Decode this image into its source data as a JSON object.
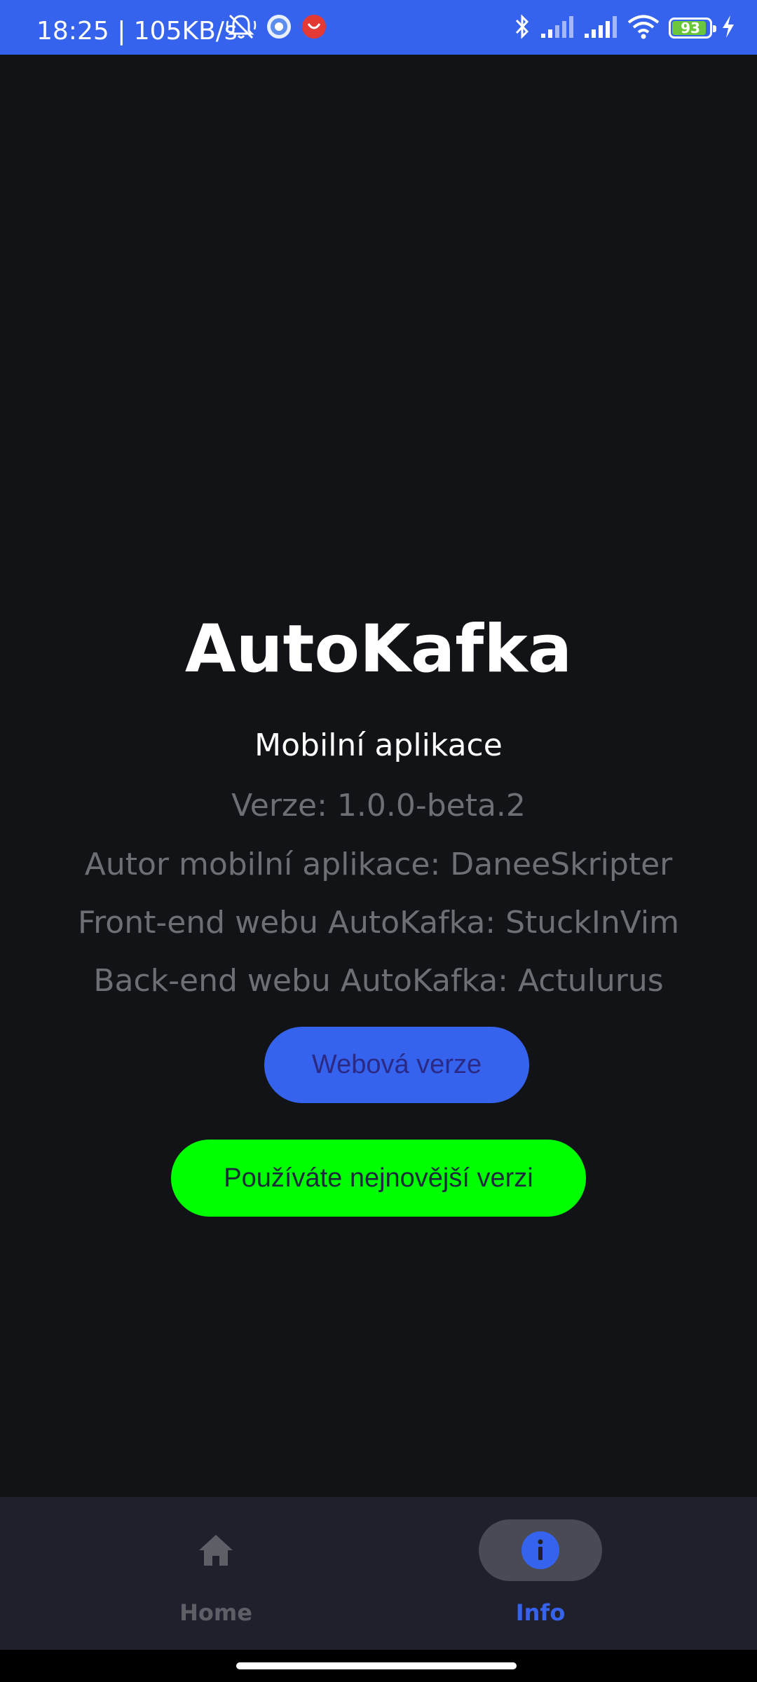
{
  "status_bar": {
    "time_and_speed": "18:25 | 105KB/s",
    "battery_level": "93",
    "battery_fraction": 0.93,
    "bg_color": "#3563EE",
    "icons": [
      "mute-bell-icon",
      "app-notification-icon",
      "app-notification-icon-2",
      "bluetooth-icon",
      "signal-icon",
      "signal-icon-2",
      "wifi-icon",
      "battery-icon",
      "charging-icon"
    ]
  },
  "app": {
    "title": "AutoKafka",
    "subtitle": "Mobilní aplikace",
    "version": "Verze: 1.0.0-beta.2",
    "mobile_author": "Autor mobilní aplikace: DaneeSkripter",
    "frontend_author": "Front-end webu AutoKafka: StuckInVim",
    "backend_author": "Back-end webu AutoKafka: Actulurus"
  },
  "buttons": {
    "web_version": "Webová verze",
    "update_status": "Používáte nejnovější verzi"
  },
  "colors": {
    "accent": "#3563EE",
    "update_green": "#00FF00",
    "background": "#121317",
    "nav_background": "#1F202C"
  },
  "bottom_nav": {
    "items": [
      {
        "label": "Home",
        "icon": "home-icon",
        "selected": false
      },
      {
        "label": "Info",
        "icon": "info-icon",
        "selected": true
      }
    ]
  }
}
